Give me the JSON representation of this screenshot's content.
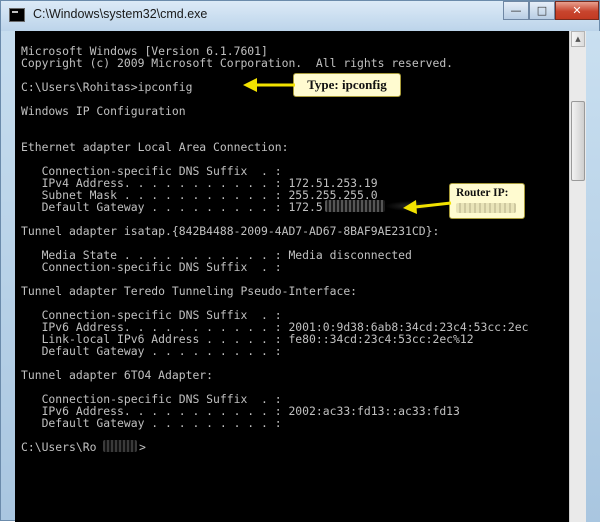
{
  "window": {
    "title": "C:\\Windows\\system32\\cmd.exe",
    "controls": {
      "minimize": "—",
      "maximize": "□",
      "close": "✕"
    }
  },
  "console": {
    "lines": [
      "Microsoft Windows [Version 6.1.7601]",
      "Copyright (c) 2009 Microsoft Corporation.  All rights reserved.",
      "",
      "C:\\Users\\Rohitas>ipconfig",
      "",
      "Windows IP Configuration",
      "",
      "",
      "Ethernet adapter Local Area Connection:",
      "",
      "   Connection-specific DNS Suffix  . :",
      "   IPv4 Address. . . . . . . . . . . : 172.51.253.19",
      "   Subnet Mask . . . . . . . . . . . : 255.255.255.0",
      "   Default Gateway . . . . . . . . . : 172.5",
      "",
      "Tunnel adapter isatap.{842B4488-2009-4AD7-AD67-8BAF9AE231CD}:",
      "",
      "   Media State . . . . . . . . . . . : Media disconnected",
      "   Connection-specific DNS Suffix  . :",
      "",
      "Tunnel adapter Teredo Tunneling Pseudo-Interface:",
      "",
      "   Connection-specific DNS Suffix  . :",
      "   IPv6 Address. . . . . . . . . . . : 2001:0:9d38:6ab8:34cd:23c4:53cc:2ec",
      "   Link-local IPv6 Address . . . . . : fe80::34cd:23c4:53cc:2ec%12",
      "   Default Gateway . . . . . . . . . :",
      "",
      "Tunnel adapter 6TO4 Adapter:",
      "",
      "   Connection-specific DNS Suffix  . :",
      "   IPv6 Address. . . . . . . . . . . : 2002:ac33:fd13::ac33:fd13",
      "   Default Gateway . . . . . . . . . :",
      "",
      "C:\\Users\\Ro",
      ""
    ],
    "prompt_tail": ">"
  },
  "annotations": {
    "ipconfig_callout": "Type: ipconfig",
    "router_callout": "Router IP:",
    "arrow_color": "#f2e200"
  },
  "colors": {
    "console_bg": "#000000",
    "console_text": "#c0c0c0",
    "callout_bg": "#fffbd0"
  }
}
